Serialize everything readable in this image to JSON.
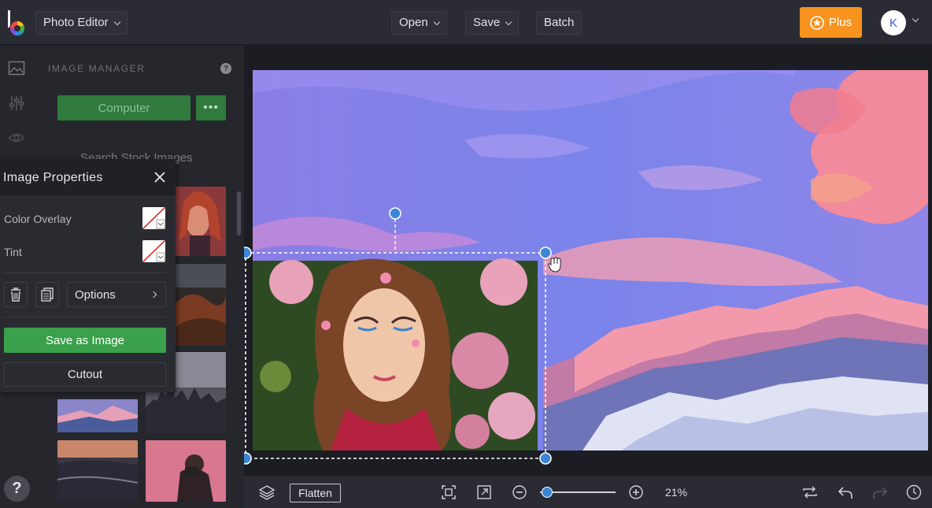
{
  "header": {
    "app_switcher": "Photo Editor",
    "menu_open": "Open",
    "menu_save": "Save",
    "menu_batch": "Batch",
    "plus_label": "Plus",
    "avatar_initial": "K"
  },
  "image_manager": {
    "title": "IMAGE MANAGER",
    "computer_button": "Computer",
    "more_button": "•••",
    "stock_search": "Search Stock Images"
  },
  "image_properties": {
    "title": "Image Properties",
    "color_overlay_label": "Color Overlay",
    "tint_label": "Tint",
    "options_label": "Options",
    "save_as_image": "Save as Image",
    "cutout": "Cutout"
  },
  "bottom_bar": {
    "flatten": "Flatten",
    "zoom_value": "21%",
    "zoom_fraction": 0.03
  },
  "help": {
    "label": "?"
  },
  "colors": {
    "accent_green": "#3aa04b",
    "plus_orange": "#f7931e",
    "selection_blue": "#3b86d6"
  },
  "icons": [
    "image-icon",
    "sliders-icon",
    "eye-icon",
    "help-icon",
    "close-icon",
    "trash-icon",
    "copy-icon",
    "layers-icon",
    "fit-screen-icon",
    "expand-icon",
    "zoom-out-icon",
    "zoom-in-icon",
    "swap-icon",
    "undo-icon",
    "redo-icon",
    "history-icon",
    "star-icon",
    "drag-hand-icon"
  ]
}
